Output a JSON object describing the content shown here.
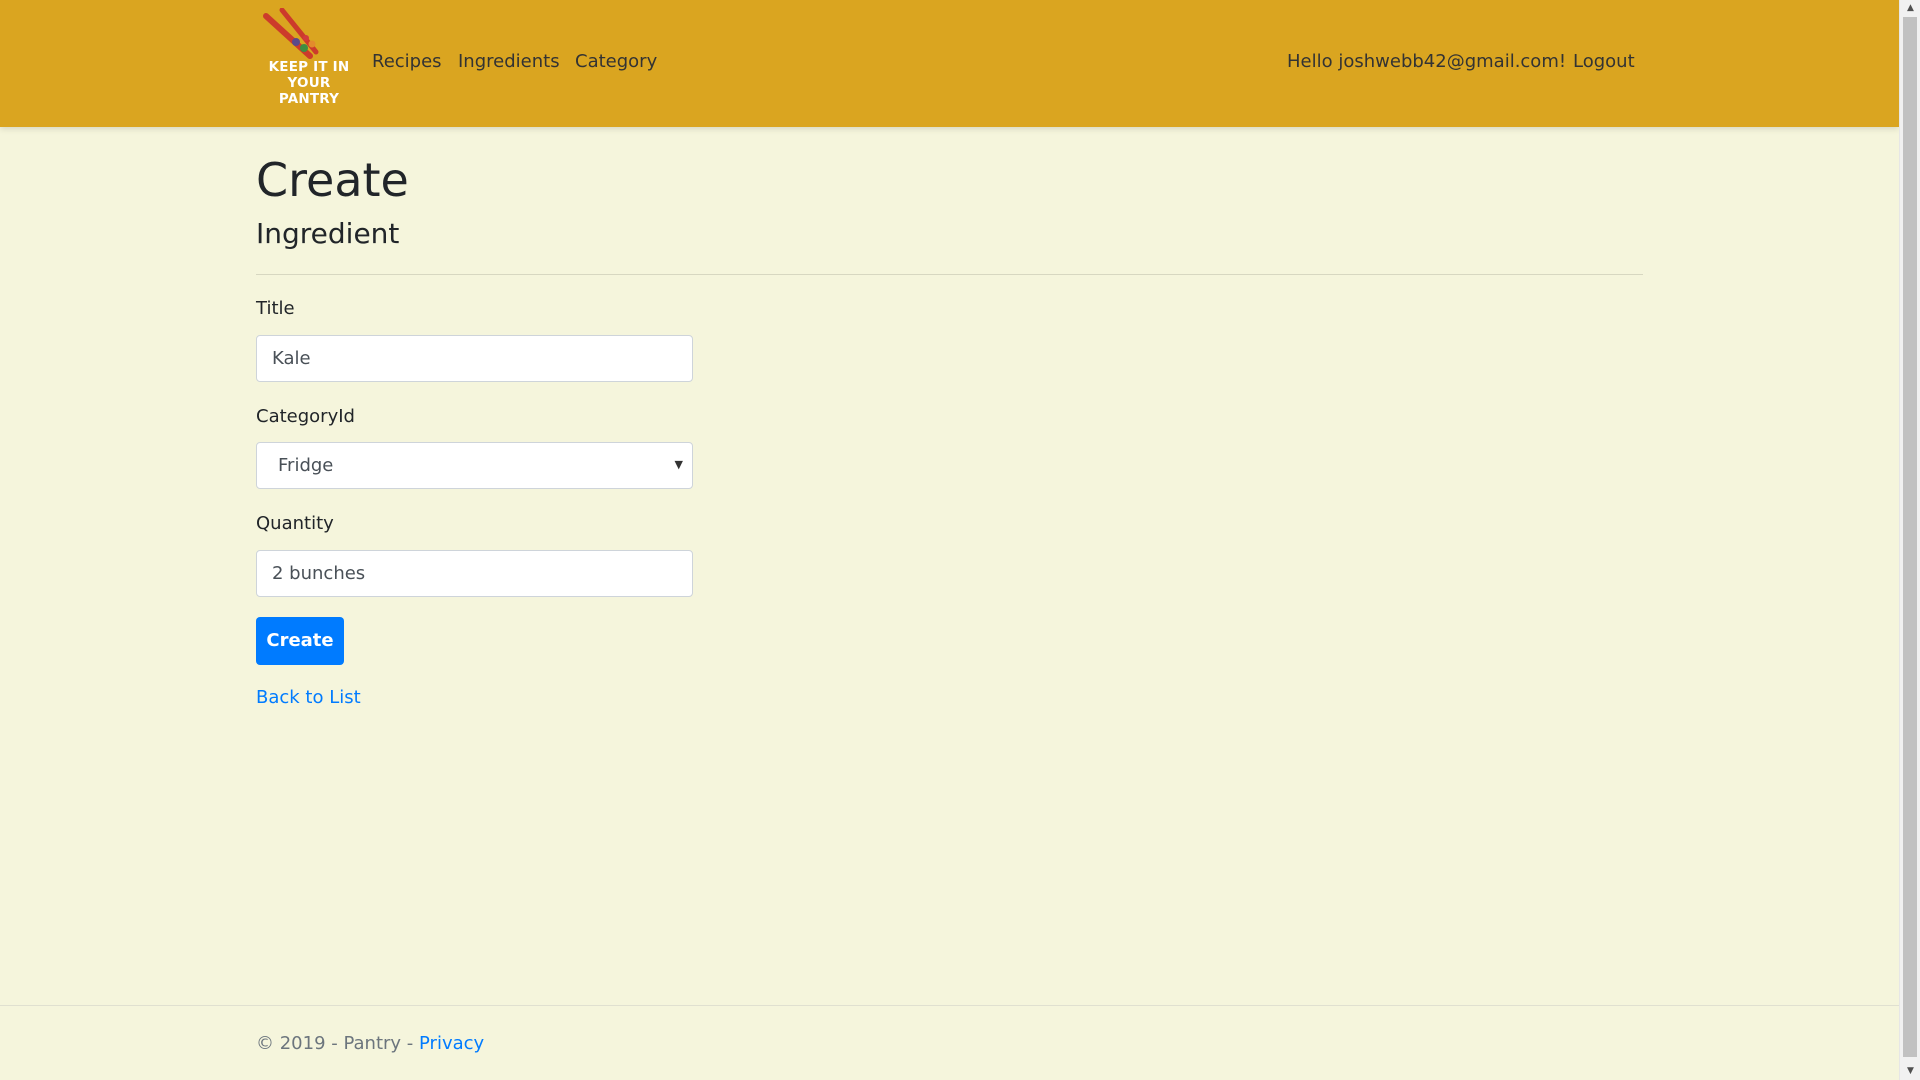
{
  "header": {
    "brand_line1": "KEEP IT IN",
    "brand_line2": "YOUR PANTRY",
    "nav": {
      "recipes": "Recipes",
      "ingredients": "Ingredients",
      "category": "Category"
    },
    "greeting": "Hello joshwebb42@gmail.com!",
    "logout": "Logout"
  },
  "main": {
    "title": "Create",
    "subtitle": "Ingredient",
    "form": {
      "title_label": "Title",
      "title_value": "Kale",
      "category_label": "CategoryId",
      "category_value": "Fridge",
      "quantity_label": "Quantity",
      "quantity_value": "2 bunches",
      "submit_label": "Create"
    },
    "back_link": "Back to List"
  },
  "footer": {
    "copyright": "© 2019 - Pantry - ",
    "privacy": "Privacy"
  },
  "colors": {
    "header_bg": "#daa520",
    "page_bg": "#f5f5dc",
    "primary": "#007bff"
  }
}
